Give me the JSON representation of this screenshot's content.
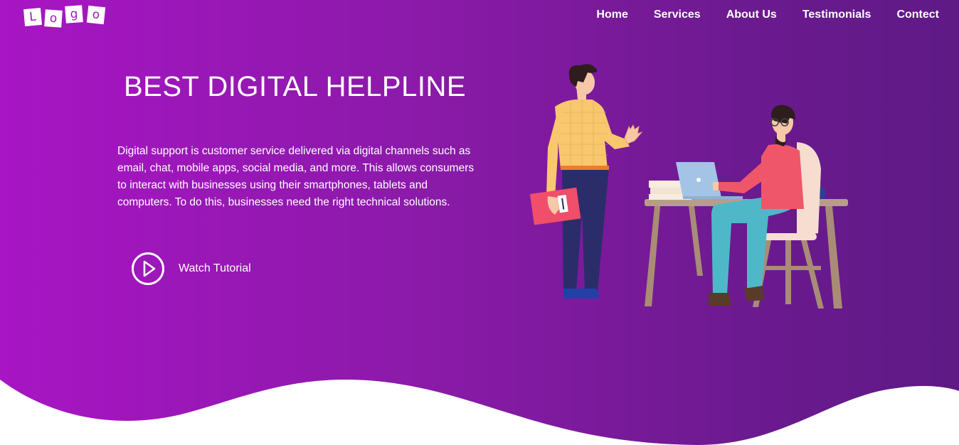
{
  "nav": {
    "logo_letters": [
      "L",
      "o",
      "g",
      "o"
    ],
    "links": [
      "Home",
      "Services",
      "About Us",
      "Testimonials",
      "Contect"
    ]
  },
  "hero": {
    "title": "BEST DIGITAL HELPLINE",
    "description": "Digital support is customer service delivered via digital channels such as email, chat, mobile apps, social media, and more. This allows consumers to interact with businesses using their smartphones, tablets and computers. To do this, businesses need the right technical solutions.",
    "cta_label": "Watch Tutorial",
    "cta_icon": "play-circle-icon"
  },
  "colors": {
    "gradient_start": "#a815c4",
    "gradient_end": "#5f1a86",
    "wave": "#ffffff"
  }
}
